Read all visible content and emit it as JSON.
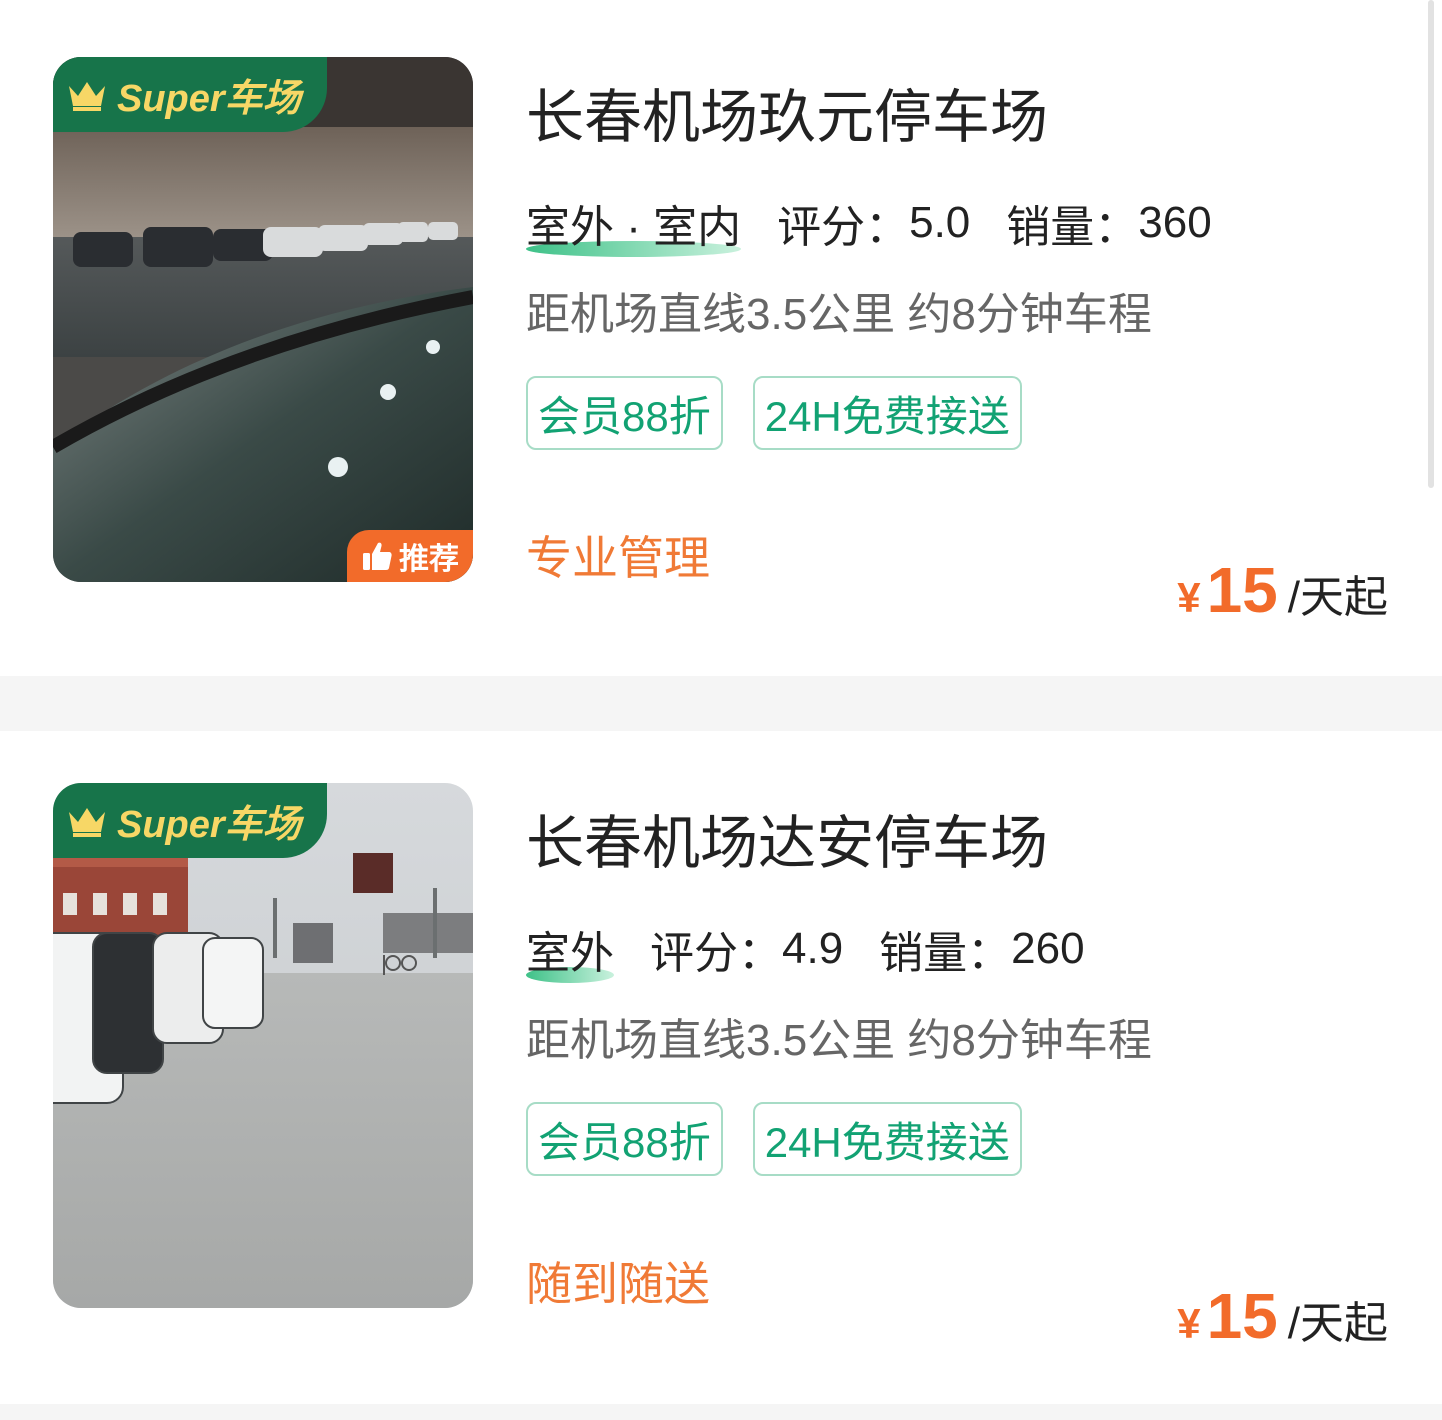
{
  "listings": [
    {
      "super_badge": "Super车场",
      "recommend_badge": "推荐",
      "name": "长春机场玖元停车场",
      "place_type": "室外 · 室内",
      "rating_label": "评分：",
      "rating": "5.0",
      "sales_label": "销量：",
      "sales": "360",
      "distance": "距机场直线3.5公里 约8分钟车程",
      "tags": [
        "会员88折",
        "24H免费接送"
      ],
      "feature": "专业管理",
      "price_currency": "¥",
      "price_value": "15",
      "price_unit": "/天起"
    },
    {
      "super_badge": "Super车场",
      "name": "长春机场达安停车场",
      "place_type": "室外",
      "rating_label": "评分：",
      "rating": "4.9",
      "sales_label": "销量：",
      "sales": "260",
      "distance": "距机场直线3.5公里 约8分钟车程",
      "tags": [
        "会员88折",
        "24H免费接送"
      ],
      "feature": "随到随送",
      "price_currency": "¥",
      "price_value": "15",
      "price_unit": "/天起"
    }
  ],
  "colors": {
    "accent_green": "#12a273",
    "badge_green": "#17744a",
    "price_orange": "#f26b2a",
    "feature_orange": "#f07a36",
    "tag_border": "#a7dcc6"
  }
}
